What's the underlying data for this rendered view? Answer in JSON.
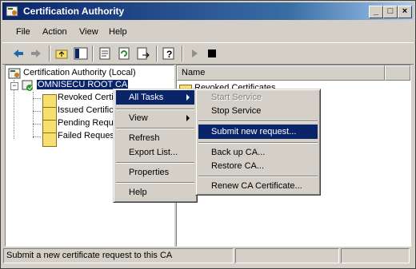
{
  "window": {
    "title": "Certification Authority"
  },
  "menubar": {
    "file": "File",
    "action": "Action",
    "view": "View",
    "help": "Help"
  },
  "tree": {
    "root": "Certification Authority (Local)",
    "ca": "OMNISECU ROOT CA",
    "children": [
      "Revoked Certifi",
      "Issued Certific",
      "Pending Reque",
      "Failed Request"
    ]
  },
  "list": {
    "column_name": "Name",
    "first_item": "Revoked Certificates"
  },
  "context_menu": {
    "all_tasks": "All Tasks",
    "view": "View",
    "refresh": "Refresh",
    "export_list": "Export List...",
    "properties": "Properties",
    "help": "Help"
  },
  "submenu": {
    "start_service": "Start Service",
    "stop_service": "Stop Service",
    "submit_new_request": "Submit new request...",
    "back_up_ca": "Back up CA...",
    "restore_ca": "Restore CA...",
    "renew_ca_certificate": "Renew CA Certificate..."
  },
  "status": {
    "text": "Submit a new certificate request to this CA"
  },
  "colors": {
    "title_bar": "#0a246a",
    "highlight": "#0a246a",
    "face": "#d4d0c8"
  },
  "icons": [
    "app-icon",
    "back-arrow-icon",
    "forward-arrow-icon",
    "up-folder-icon",
    "show-tree-icon",
    "properties-icon",
    "refresh-icon",
    "export-icon",
    "help-icon",
    "play-icon",
    "stop-icon"
  ]
}
